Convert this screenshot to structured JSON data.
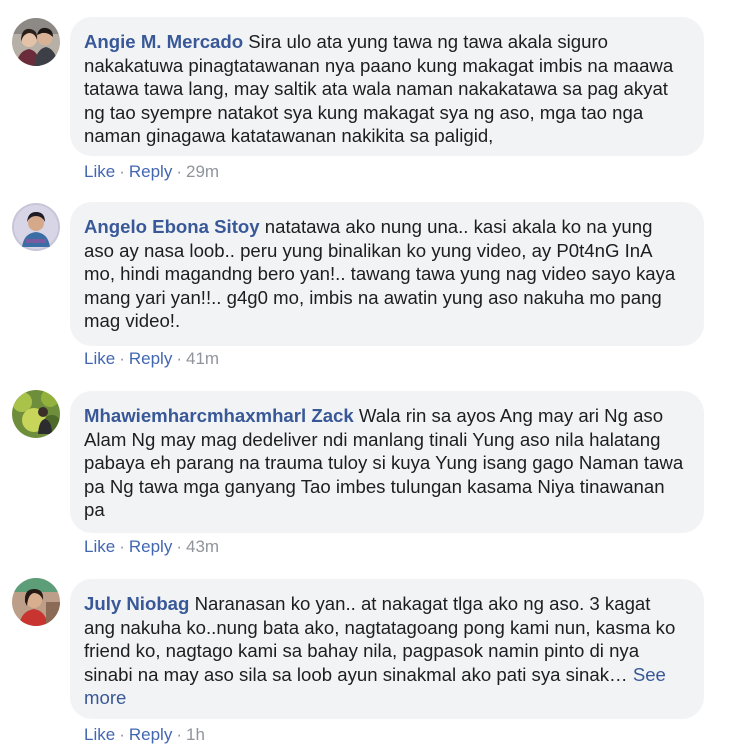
{
  "comments": [
    {
      "author": "Angie M. Mercado",
      "text": "Sira ulo ata yung tawa ng tawa akala siguro nakakatuwa pinagtatawanan nya paano kung makagat imbis na maawa tatawa tawa lang, may saltik ata wala naman nakakatawa sa pag akyat ng tao syempre natakot sya kung makagat sya ng aso, mga tao nga naman ginagawa katatawanan nakikita sa paligid,",
      "like": "Like",
      "reply": "Reply",
      "time": "29m"
    },
    {
      "author": "Angelo Ebona Sitoy",
      "text": "natatawa ako nung una.. kasi akala ko na yung aso ay nasa loob.. peru yung binalikan ko yung video, ay P0t4nG InA mo, hindi magandng bero yan!.. tawang tawa yung nag video sayo kaya mang yari yan!!.. g4g0 mo, imbis na awatin yung aso nakuha mo pang mag video!.",
      "like": "Like",
      "reply": "Reply",
      "time": "41m"
    },
    {
      "author": "Mhawiemharcmhaxmharl Zack",
      "text": "Wala rin sa ayos Ang may ari Ng aso Alam Ng may mag dedeliver ndi manlang tinali Yung aso nila halatang pabaya eh parang na trauma tuloy si kuya Yung isang gago Naman tawa pa Ng tawa mga ganyang Tao imbes tulungan kasama Niya tinawanan pa",
      "like": "Like",
      "reply": "Reply",
      "time": "43m"
    },
    {
      "author": "July Niobag",
      "text": "Naranasan ko yan.. at nakagat tlga ako ng aso. 3 kagat ang nakuha ko..nung bata ako, nagtatagoang pong kami nun, kasma ko friend ko, nagtago kami sa bahay nila, pagpasok namin pinto di nya sinabi na may aso sila sa loob ayun sinakmal ako pati sya sinak…",
      "see_more": "See more",
      "like": "Like",
      "reply": "Reply",
      "time": "1h"
    }
  ],
  "separator": "·"
}
